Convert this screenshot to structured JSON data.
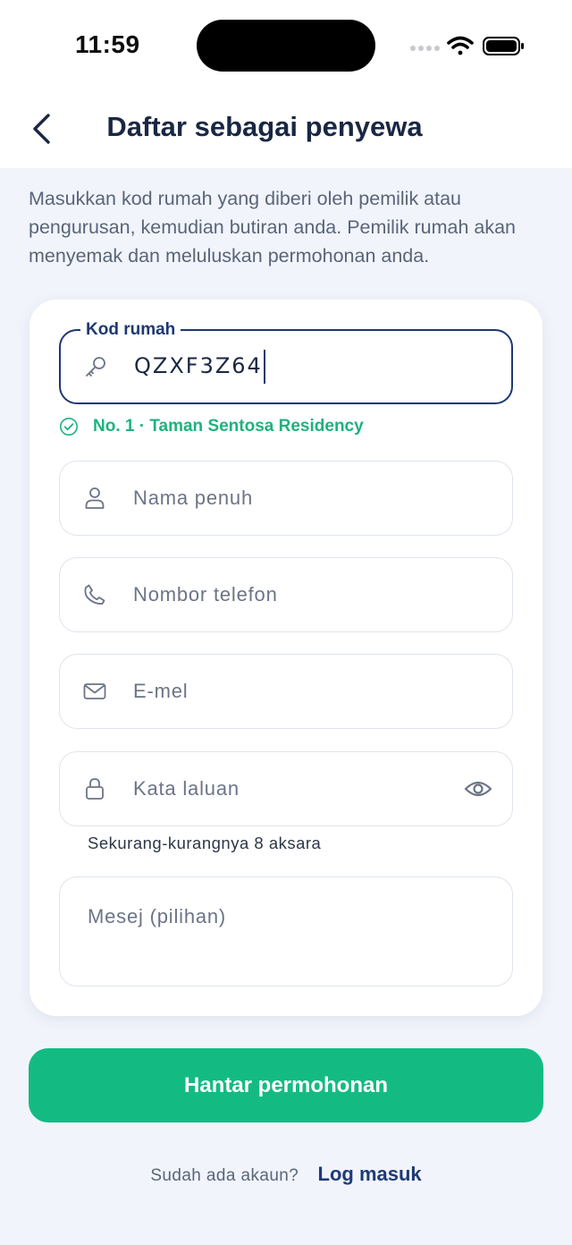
{
  "status_bar": {
    "time": "11:59"
  },
  "header": {
    "title": "Daftar sebagai penyewa"
  },
  "intro": "Masukkan kod rumah yang diberi oleh pemilik atau pengurusan, kemudian butiran anda. Pemilik rumah akan menyemak dan meluluskan permohonan anda.",
  "form": {
    "house_code": {
      "label": "Kod rumah",
      "value": "QZXF3Z64",
      "icon": "key-icon"
    },
    "code_result": "No. 1 · Taman Sentosa Residency",
    "full_name": {
      "placeholder": "Nama penuh",
      "icon": "user-icon"
    },
    "phone": {
      "placeholder": "Nombor telefon",
      "icon": "phone-icon"
    },
    "email": {
      "placeholder": "E-mel",
      "icon": "mail-icon"
    },
    "password": {
      "placeholder": "Kata laluan",
      "icon": "lock-icon",
      "hint": "Sekurang-kurangnya 8 aksara"
    },
    "message": {
      "placeholder": "Mesej (pilihan)"
    }
  },
  "submit_label": "Hantar permohonan",
  "footer": {
    "question": "Sudah ada akaun?",
    "login_label": "Log masuk"
  },
  "colors": {
    "primary": "#1e3872",
    "accent": "#13bb83",
    "background": "#f1f4fb"
  }
}
